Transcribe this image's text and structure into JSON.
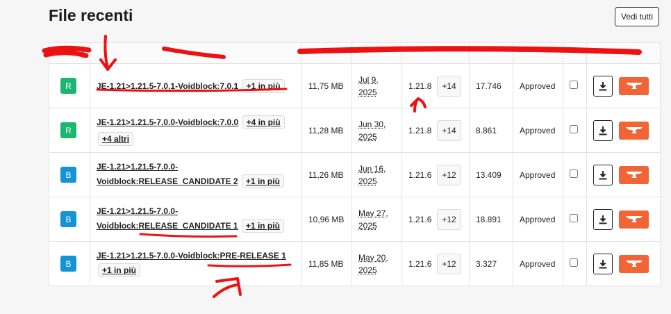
{
  "page": {
    "title": "File recenti",
    "view_all_label": "Vedi tutti"
  },
  "table": {
    "sort_icon": "sort-icon",
    "rows": [
      {
        "type": "R",
        "type_color": "#1bb76e",
        "name": "JE-1.21>1.21.5-7.0.1-Voidblock:7.0.1",
        "name_extra": "+1 in più",
        "name_extra2": "",
        "size": "11,75 MB",
        "date_line1": "Jul 9,",
        "date_line2": "2025",
        "version": "1.21.8",
        "version_more": "+14",
        "downloads": "17.746",
        "status": "Approved"
      },
      {
        "type": "R",
        "type_color": "#1bb76e",
        "name": "JE-1.21>1.21.5-7.0.0-Voidblock:7.0.0",
        "name_extra": "+4 in più",
        "name_extra2": "+4 altri",
        "size": "11,28 MB",
        "date_line1": "Jun 30,",
        "date_line2": "2025",
        "version": "1.21.8",
        "version_more": "+14",
        "downloads": "8.861",
        "status": "Approved"
      },
      {
        "type": "B",
        "type_color": "#1394d7",
        "name": "JE-1.21>1.21.5-7.0.0-Voidblock:RELEASE_CANDIDATE 2",
        "name_extra": "+1 in più",
        "name_extra2": "",
        "size": "11,26 MB",
        "date_line1": "Jun 16,",
        "date_line2": "2025",
        "version": "1.21.6",
        "version_more": "+12",
        "downloads": "13.409",
        "status": "Approved"
      },
      {
        "type": "B",
        "type_color": "#1394d7",
        "name": "JE-1.21>1.21.5-7.0.0-Voidblock:RELEASE_CANDIDATE 1",
        "name_extra": "+1 in più",
        "name_extra2": "",
        "size": "10,96 MB",
        "date_line1": "May 27,",
        "date_line2": "2025",
        "version": "1.21.6",
        "version_more": "+12",
        "downloads": "18.891",
        "status": "Approved"
      },
      {
        "type": "B",
        "type_color": "#1394d7",
        "name": "JE-1.21>1.21.5-7.0.0-Voidblock:PRE-RELEASE 1",
        "name_extra": "+1 in più",
        "name_extra2": "",
        "size": "11,85 MB",
        "date_line1": "May 20,",
        "date_line2": "2025",
        "version": "1.21.6",
        "version_more": "+12",
        "downloads": "3.327",
        "status": "Approved"
      }
    ]
  },
  "actions": {
    "download_icon": "download-icon",
    "curseforge_icon": "anvil-icon",
    "download_color": "#222222",
    "curseforge_color": "#f16436"
  },
  "annotations": {
    "stroke_color": "#ee1111"
  }
}
